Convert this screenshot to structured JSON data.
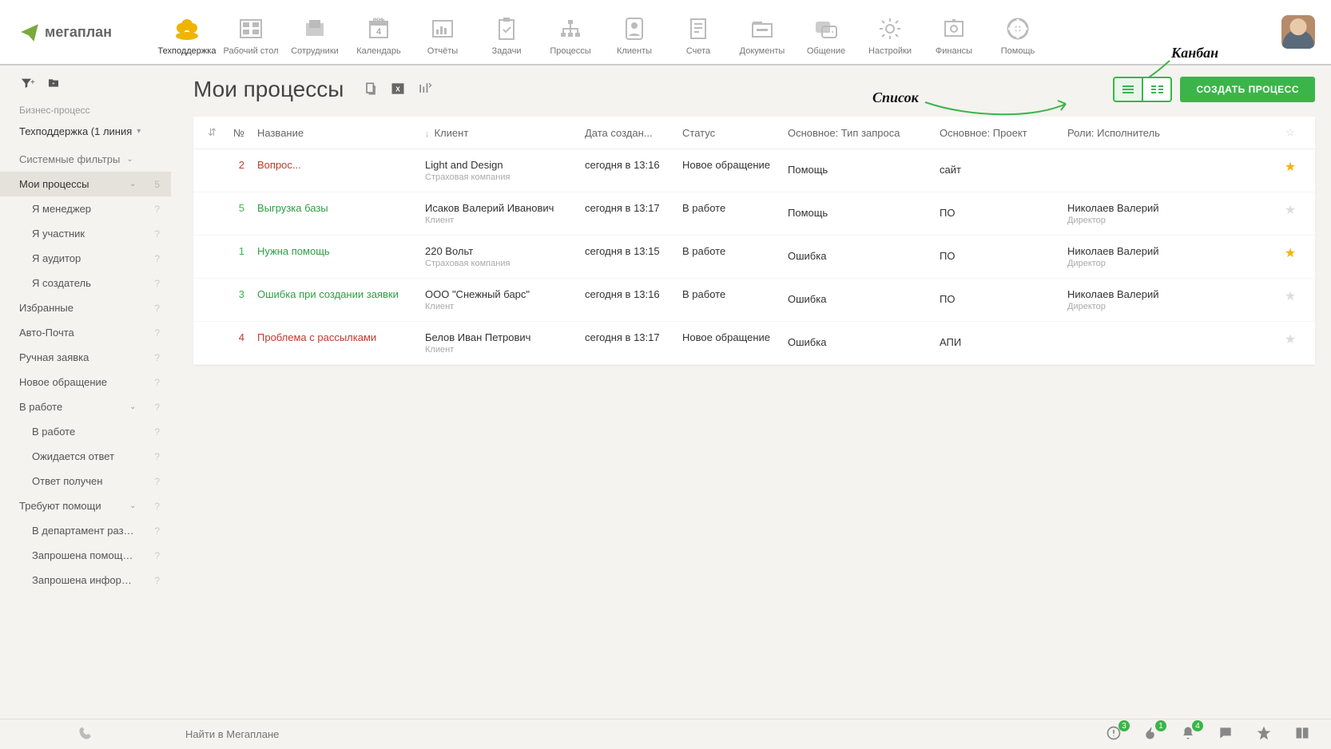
{
  "brand": "мегаплан",
  "nav": [
    {
      "label": "Техподдержка",
      "active": true
    },
    {
      "label": "Рабочий стол"
    },
    {
      "label": "Сотрудники"
    },
    {
      "label": "Календарь"
    },
    {
      "label": "Отчёты"
    },
    {
      "label": "Задачи"
    },
    {
      "label": "Процессы"
    },
    {
      "label": "Клиенты"
    },
    {
      "label": "Счета"
    },
    {
      "label": "Документы"
    },
    {
      "label": "Общение"
    },
    {
      "label": "Настройки"
    },
    {
      "label": "Финансы"
    },
    {
      "label": "Помощь"
    }
  ],
  "annotations": {
    "kanban": "Канбан",
    "list": "Список"
  },
  "sidebar": {
    "bpHeading": "Бизнес-процесс",
    "bpSelected": "Техподдержка (1 линия",
    "sysFilters": "Системные фильтры",
    "items": [
      {
        "label": "Мои процессы",
        "count": "5",
        "active": true,
        "chev": true
      },
      {
        "label": "Я менеджер",
        "sub": true,
        "q": true
      },
      {
        "label": "Я участник",
        "sub": true,
        "q": true
      },
      {
        "label": "Я аудитор",
        "sub": true,
        "q": true
      },
      {
        "label": "Я создатель",
        "sub": true,
        "q": true
      },
      {
        "label": "Избранные",
        "q": true
      },
      {
        "label": "Авто-Почта",
        "q": true
      },
      {
        "label": "Ручная заявка",
        "q": true
      },
      {
        "label": "Новое обращение",
        "q": true
      },
      {
        "label": "В работе",
        "chev": true,
        "q": true
      },
      {
        "label": "В работе",
        "sub": true,
        "q": true
      },
      {
        "label": "Ожидается ответ",
        "sub": true,
        "q": true
      },
      {
        "label": "Ответ получен",
        "sub": true,
        "q": true
      },
      {
        "label": "Требуют помощи",
        "chev": true,
        "q": true
      },
      {
        "label": "В департамент разра...",
        "sub": true,
        "q": true
      },
      {
        "label": "Запрошена помощь ...",
        "sub": true,
        "q": true
      },
      {
        "label": "Запрошена информа...",
        "sub": true,
        "q": true
      }
    ]
  },
  "page": {
    "title": "Мои процессы",
    "createBtn": "СОЗДАТЬ ПРОЦЕСС"
  },
  "table": {
    "headers": {
      "no": "№",
      "name": "Название",
      "client": "Клиент",
      "date": "Дата создан...",
      "status": "Статус",
      "type": "Основное: Тип запроса",
      "project": "Основное: Проект",
      "role": "Роли: Исполнитель"
    },
    "rows": [
      {
        "no": "2",
        "noCls": "no-red",
        "name": "Вопрос...",
        "nameCls": "name-red",
        "client": "Light and Design",
        "clientSub": "Страховая компания",
        "date": "сегодня в 13:16",
        "status": "Новое обращение",
        "type": "Помощь",
        "project": "сайт",
        "role": "",
        "roleSub": "",
        "star": true
      },
      {
        "no": "5",
        "noCls": "no-green",
        "name": "Выгрузка базы",
        "nameCls": "name-green",
        "client": "Исаков Валерий Иванович",
        "clientSub": "Клиент",
        "date": "сегодня в 13:17",
        "status": "В работе",
        "type": "Помощь",
        "project": "ПО",
        "role": "Николаев Валерий",
        "roleSub": "Директор",
        "star": false
      },
      {
        "no": "1",
        "noCls": "no-green",
        "name": "Нужна помощь",
        "nameCls": "name-green",
        "client": "220 Вольт",
        "clientSub": "Страховая компания",
        "date": "сегодня в 13:15",
        "status": "В работе",
        "type": "Ошибка",
        "project": "ПО",
        "role": "Николаев Валерий",
        "roleSub": "Директор",
        "star": true
      },
      {
        "no": "3",
        "noCls": "no-green",
        "name": "Ошибка при создании заявки",
        "nameCls": "name-green",
        "client": "ООО \"Снежный барс\"",
        "clientSub": "Клиент",
        "date": "сегодня в 13:16",
        "status": "В работе",
        "type": "Ошибка",
        "project": "ПО",
        "role": "Николаев Валерий",
        "roleSub": "Директор",
        "star": false
      },
      {
        "no": "4",
        "noCls": "no-red",
        "name": "Проблема с рассылками",
        "nameCls": "name-red",
        "client": "Белов Иван Петрович",
        "clientSub": "Клиент",
        "date": "сегодня в 13:17",
        "status": "Новое обращение",
        "type": "Ошибка",
        "project": "АПИ",
        "role": "",
        "roleSub": "",
        "star": false
      }
    ]
  },
  "bottom": {
    "searchPlaceholder": "Найти в Мегаплане",
    "badges": {
      "alert": "3",
      "fire": "1",
      "bell": "4"
    }
  }
}
